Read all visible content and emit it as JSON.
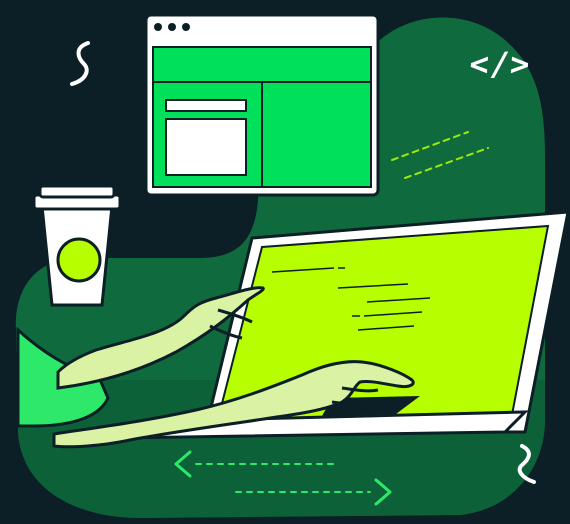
{
  "illustration": {
    "code_tag_text": "</>",
    "colors": {
      "background": "#0d1f26",
      "blob": "#0f6b3e",
      "blob_dark": "#0b4f31",
      "window_green": "#00e05a",
      "screen_lime": "#b7ff00",
      "skin": "#d9f2a3",
      "sleeve": "#2ee86a",
      "white": "#ffffff",
      "outline": "#0d1f26"
    },
    "icons": [
      "browser-window-icon",
      "coffee-cup-icon",
      "laptop-icon",
      "code-tag-icon",
      "squiggle-icon",
      "double-arrow-icon"
    ]
  }
}
